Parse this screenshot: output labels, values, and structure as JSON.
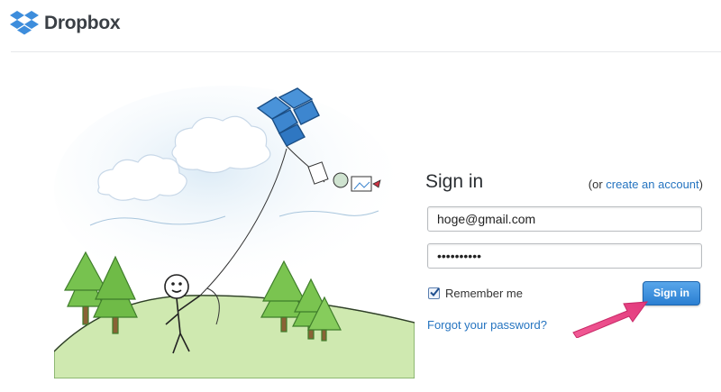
{
  "header": {
    "brand_name": "Dropbox",
    "logo_icon": "dropbox-logo-icon",
    "brand_color": "#3d8ddc"
  },
  "signin": {
    "title": "Sign in",
    "alt_prefix": "(or ",
    "alt_link": "create an account",
    "alt_suffix": ")",
    "email_value": "hoge@gmail.com",
    "password_value": "••••••••••",
    "remember_label": "Remember me",
    "remember_checked": true,
    "button_label": "Sign in",
    "forgot_link": "Forgot your password?"
  },
  "colors": {
    "link": "#2574c0",
    "button": "#2b7fd2",
    "annotation_arrow": "#ee4a8a"
  }
}
